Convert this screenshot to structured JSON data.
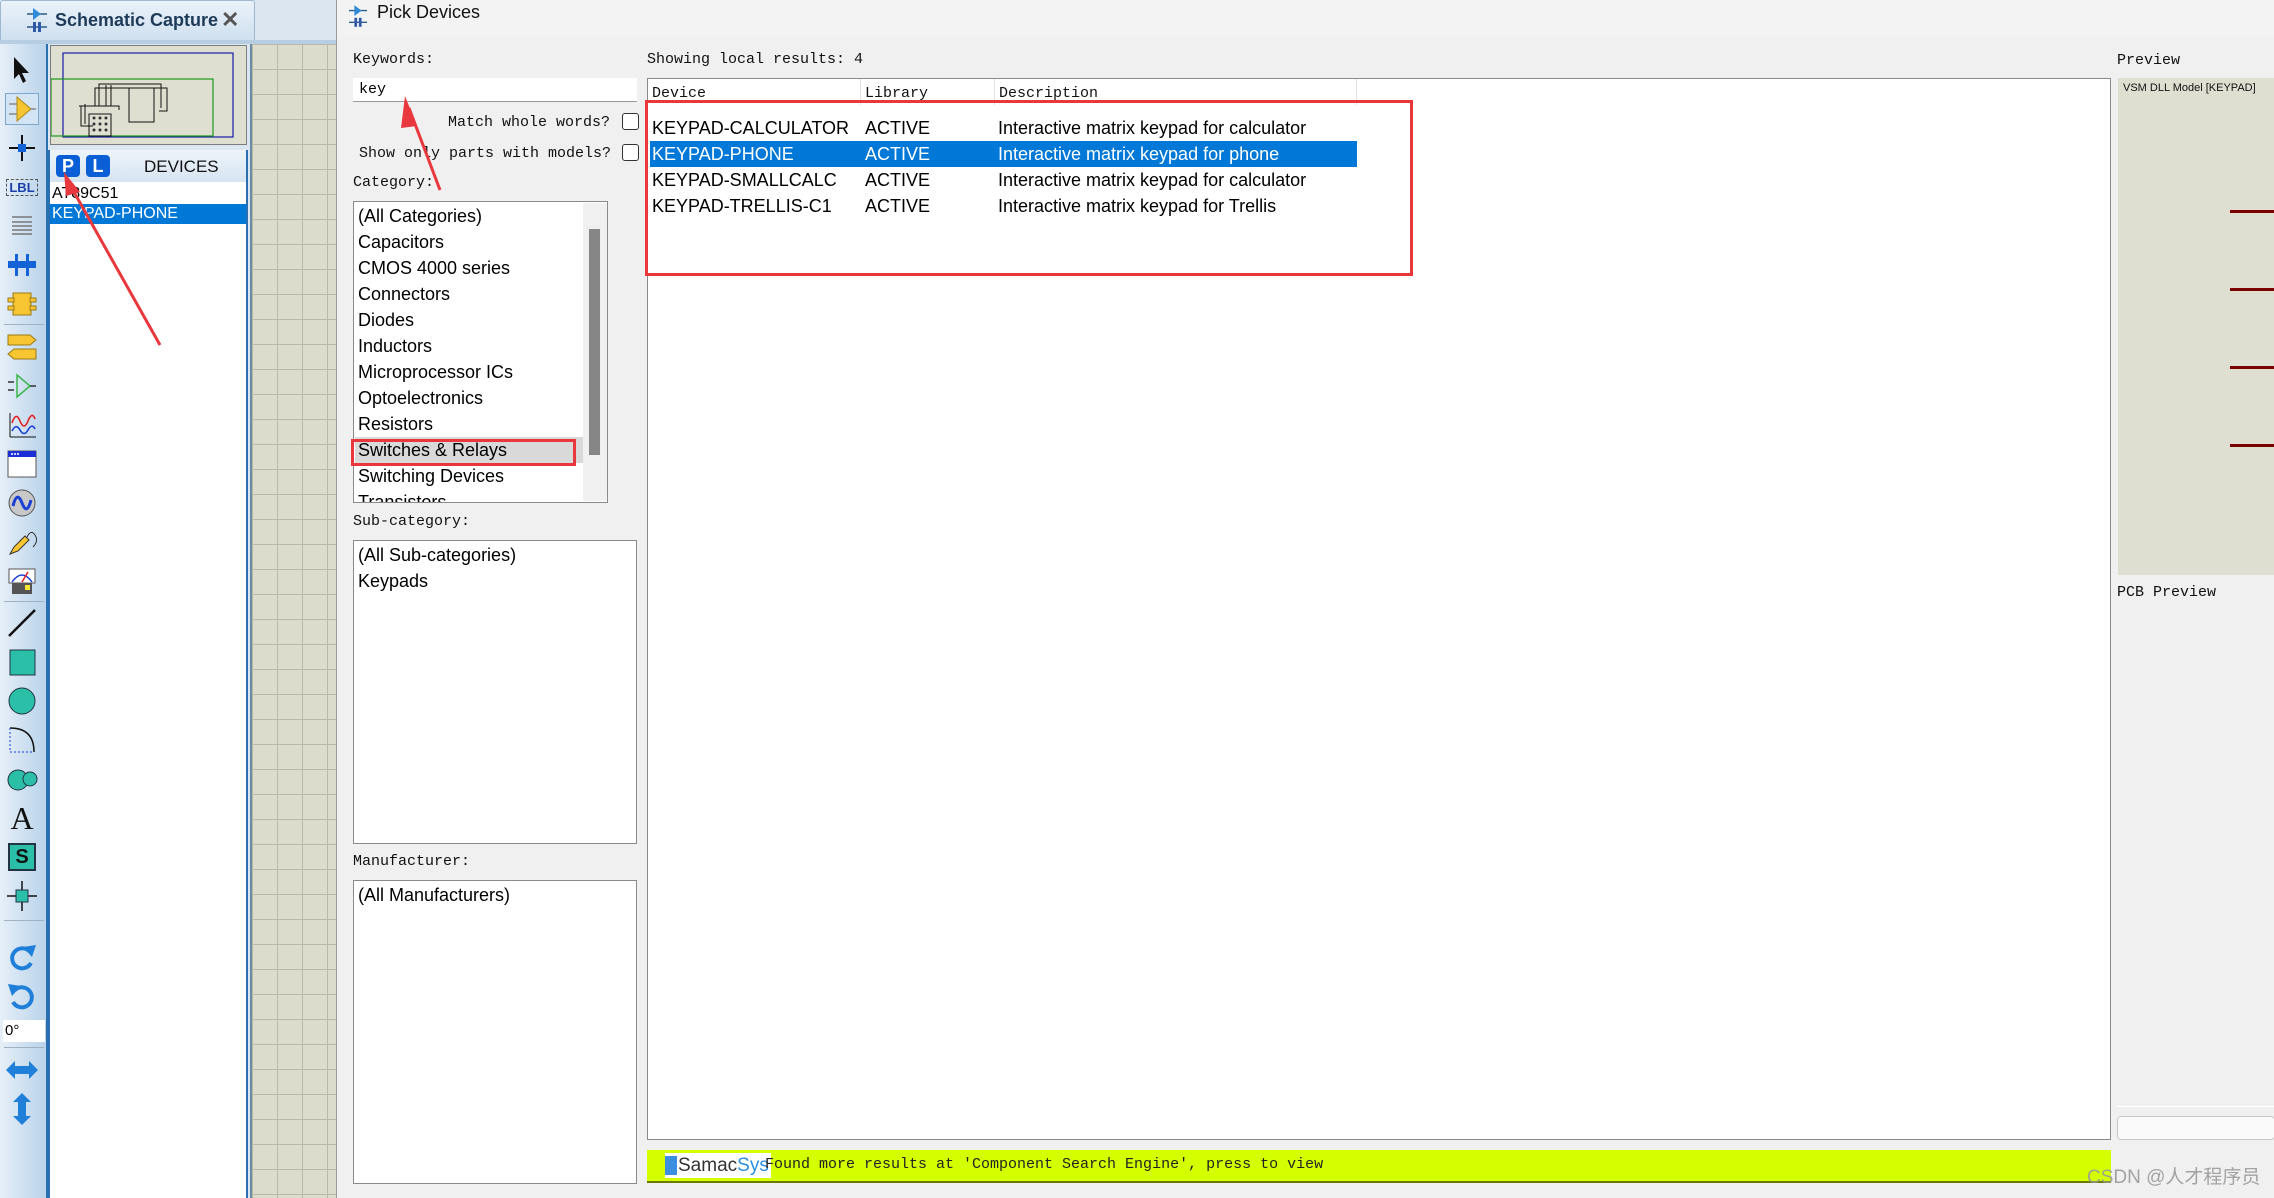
{
  "app": {
    "tab_title": "Schematic Capture",
    "tab_close": "✕",
    "angle_value": "0°"
  },
  "toolbar": {
    "tools": [
      {
        "name": "selection-mode-icon"
      },
      {
        "name": "component-mode-icon",
        "selected": true
      },
      {
        "name": "junction-dot-icon"
      },
      {
        "name": "wire-label-icon",
        "text": "LBL"
      },
      {
        "name": "text-script-icon"
      },
      {
        "name": "buses-icon"
      },
      {
        "name": "subcircuit-icon"
      },
      {
        "name": "terminals-icon"
      },
      {
        "name": "device-pins-icon"
      },
      {
        "name": "graph-icon"
      },
      {
        "name": "active-popup-icon"
      },
      {
        "name": "generator-icon"
      },
      {
        "name": "probe-icon"
      },
      {
        "name": "virtual-instruments-icon"
      },
      {
        "name": "line-icon"
      },
      {
        "name": "box-icon"
      },
      {
        "name": "circle-icon"
      },
      {
        "name": "arc-icon"
      },
      {
        "name": "closed-path-icon"
      },
      {
        "name": "text-icon",
        "text": "A"
      },
      {
        "name": "symbol-icon",
        "text": "S"
      },
      {
        "name": "marker-icon"
      },
      {
        "name": "rotate-clockwise-icon"
      },
      {
        "name": "rotate-anticlockwise-icon"
      },
      {
        "name": "mirror-horizontal-icon"
      },
      {
        "name": "mirror-vertical-icon"
      }
    ]
  },
  "devices_panel": {
    "pick_button": "P",
    "library_button": "L",
    "title": "DEVICES",
    "items": [
      {
        "label": "AT89C51",
        "selected": false
      },
      {
        "label": "KEYPAD-PHONE",
        "selected": true
      }
    ]
  },
  "dialog": {
    "title": "Pick Devices",
    "keywords_label": "Keywords:",
    "keywords_value": "key",
    "match_whole_words_label": "Match whole words?",
    "match_whole_words_checked": false,
    "show_only_models_label": "Show only parts with models?",
    "show_only_models_checked": false,
    "category_label": "Category:",
    "categories": [
      "(All Categories)",
      "Capacitors",
      "CMOS 4000 series",
      "Connectors",
      "Diodes",
      "Inductors",
      "Microprocessor ICs",
      "Optoelectronics",
      "Resistors",
      "Switches & Relays",
      "Switching Devices",
      "Transistors"
    ],
    "selected_category": "Switches & Relays",
    "subcategory_label": "Sub-category:",
    "subcategories": [
      "(All Sub-categories)",
      "Keypads"
    ],
    "manufacturer_label": "Manufacturer:",
    "manufacturers": [
      "(All Manufacturers)"
    ],
    "results_label": "Showing local results: 4",
    "results_columns": [
      "Device",
      "Library",
      "Description"
    ],
    "results": [
      {
        "device": "KEYPAD-CALCULATOR",
        "library": "ACTIVE",
        "description": "Interactive matrix keypad for calculator",
        "selected": false
      },
      {
        "device": "KEYPAD-PHONE",
        "library": "ACTIVE",
        "description": "Interactive matrix keypad for phone",
        "selected": true
      },
      {
        "device": "KEYPAD-SMALLCALC",
        "library": "ACTIVE",
        "description": "Interactive matrix keypad for calculator",
        "selected": false
      },
      {
        "device": "KEYPAD-TRELLIS-C1",
        "library": "ACTIVE",
        "description": "Interactive matrix keypad for Trellis",
        "selected": false
      }
    ],
    "samacsys": {
      "logo_left": "Samac",
      "logo_right": "Sys",
      "message": "Found more results at 'Component Search Engine', press to view",
      "bar_color": "#d4ff00"
    },
    "preview_label": "Preview",
    "preview_caption": "VSM DLL Model [KEYPAD]",
    "pcb_preview_label": "PCB Preview"
  },
  "watermark": "CSDN @人才程序员",
  "colors": {
    "selection": "#0078d7",
    "annotation_red": "#e8383d",
    "pin_color": "#7a0000"
  }
}
